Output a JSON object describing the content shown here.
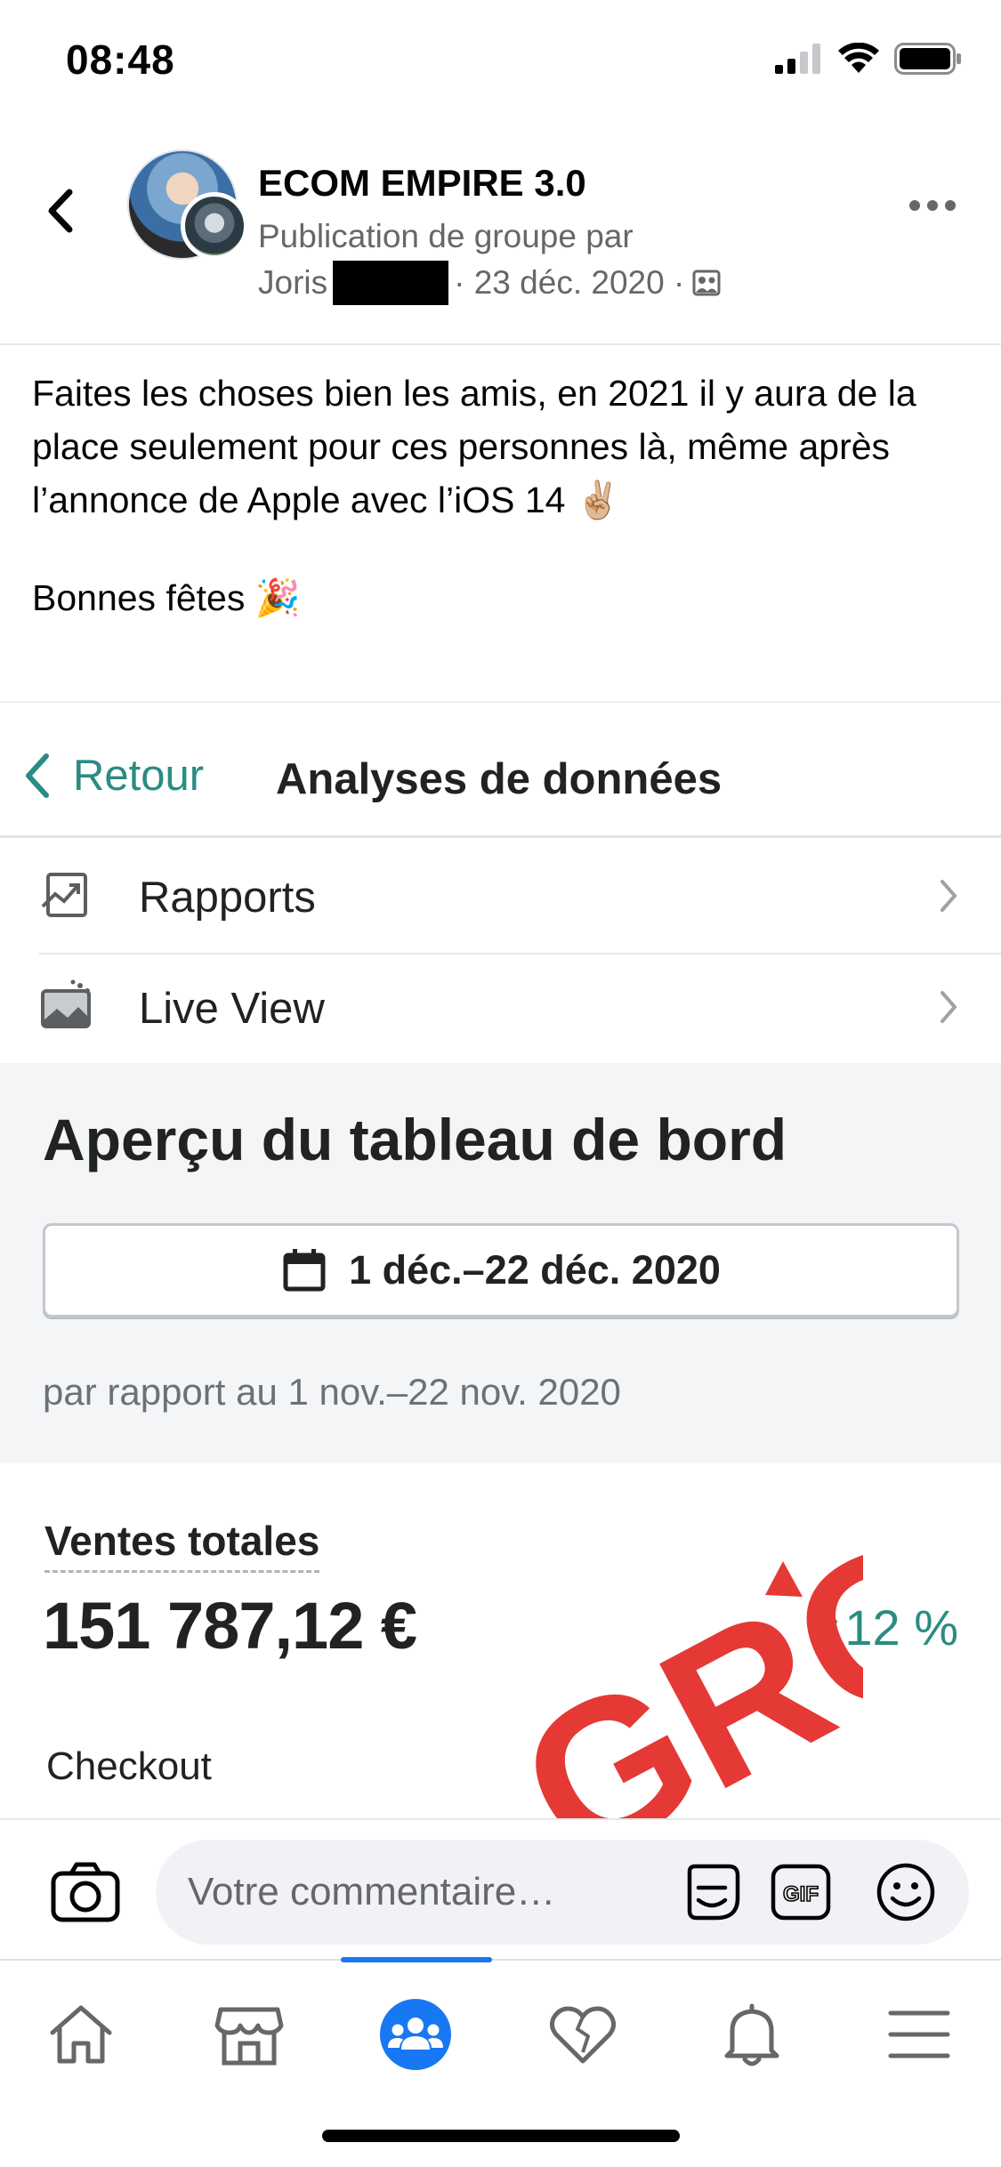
{
  "status_bar": {
    "time": "08:48"
  },
  "header": {
    "group_name": "ECOM EMPIRE 3.0",
    "subtitle": "Publication de groupe par",
    "author": "Joris",
    "date": "· 23 déc. 2020 ·"
  },
  "post": {
    "paragraph1": "Faites les choses bien les amis, en 2021 il y aura de la place seulement pour ces personnes là, même après l’annonce de Apple avec l’iOS 14 ✌🏼",
    "paragraph2": "Bonnes fêtes 🎉"
  },
  "embedded": {
    "nav": {
      "back_label": "Retour",
      "title": "Analyses de données"
    },
    "menu_items": [
      {
        "label": "Rapports",
        "icon": "reports-icon"
      },
      {
        "label": "Live View",
        "icon": "live-view-icon"
      }
    ],
    "overview_title": "Aperçu du tableau de bord",
    "date_range": "1 déc.–22 déc. 2020",
    "compare_text": "par rapport au 1 nov.–22 nov. 2020",
    "sales": {
      "label": "Ventes totales",
      "value": "151 787,12 €",
      "trend": "12 %",
      "sub_label": "Checkout"
    },
    "watermark_text": "GRC",
    "accent_color": "#2a8c82",
    "watermark_color": "#e53935"
  },
  "comment_bar": {
    "placeholder": "Votre commentaire…",
    "icons": [
      "camera-icon",
      "sticker-icon",
      "gif-icon",
      "emoji-icon"
    ],
    "gif_label": "GIF"
  },
  "tab_bar": {
    "tabs": [
      "home-icon",
      "marketplace-icon",
      "groups-icon",
      "dating-icon",
      "notifications-icon",
      "menu-icon"
    ],
    "active_tab": "groups-icon",
    "active_color": "#1877f2"
  }
}
